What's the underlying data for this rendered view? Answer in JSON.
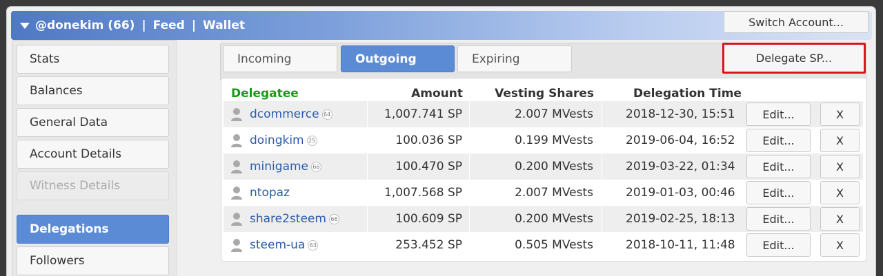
{
  "header": {
    "account": "@donekim (66)",
    "nav_feed": "Feed",
    "nav_wallet": "Wallet",
    "separator": "|",
    "switch_account": "Switch Account..."
  },
  "sidebar": {
    "items": [
      {
        "label": "Stats",
        "state": "normal"
      },
      {
        "label": "Balances",
        "state": "normal"
      },
      {
        "label": "General Data",
        "state": "normal"
      },
      {
        "label": "Account Details",
        "state": "normal"
      },
      {
        "label": "Witness Details",
        "state": "disabled"
      },
      {
        "label": "Delegations",
        "state": "active"
      },
      {
        "label": "Followers",
        "state": "normal"
      }
    ]
  },
  "tabs": [
    {
      "label": "Incoming",
      "active": false
    },
    {
      "label": "Outgoing",
      "active": true
    },
    {
      "label": "Expiring",
      "active": false
    }
  ],
  "delegate_button": "Delegate SP...",
  "table": {
    "columns": [
      "Delegatee",
      "Amount",
      "Vesting Shares",
      "Delegation Time"
    ],
    "rows": [
      {
        "user": "dcommerce",
        "rep": "64",
        "amount": "1,007.741 SP",
        "vests": "2.007 MVests",
        "time": "2018-12-30, 15:51",
        "edit": "Edit...",
        "remove": "X"
      },
      {
        "user": "doingkim",
        "rep": "25",
        "amount": "100.036 SP",
        "vests": "0.199 MVests",
        "time": "2019-06-04, 16:52",
        "edit": "Edit...",
        "remove": "X"
      },
      {
        "user": "minigame",
        "rep": "66",
        "amount": "100.470 SP",
        "vests": "0.200 MVests",
        "time": "2019-03-22, 01:34",
        "edit": "Edit...",
        "remove": "X"
      },
      {
        "user": "ntopaz",
        "rep": "",
        "amount": "1,007.568 SP",
        "vests": "2.007 MVests",
        "time": "2019-01-03, 00:46",
        "edit": "Edit...",
        "remove": "X"
      },
      {
        "user": "share2steem",
        "rep": "66",
        "amount": "100.609 SP",
        "vests": "0.200 MVests",
        "time": "2019-02-25, 18:13",
        "edit": "Edit...",
        "remove": "X"
      },
      {
        "user": "steem-ua",
        "rep": "63",
        "amount": "253.452 SP",
        "vests": "0.505 MVests",
        "time": "2018-10-11, 11:48",
        "edit": "Edit...",
        "remove": "X"
      }
    ]
  },
  "colors": {
    "accent": "#5c8bd6",
    "delegatee_header": "#159c15",
    "highlight_border": "#d9141f",
    "link": "#2a5ca8"
  }
}
